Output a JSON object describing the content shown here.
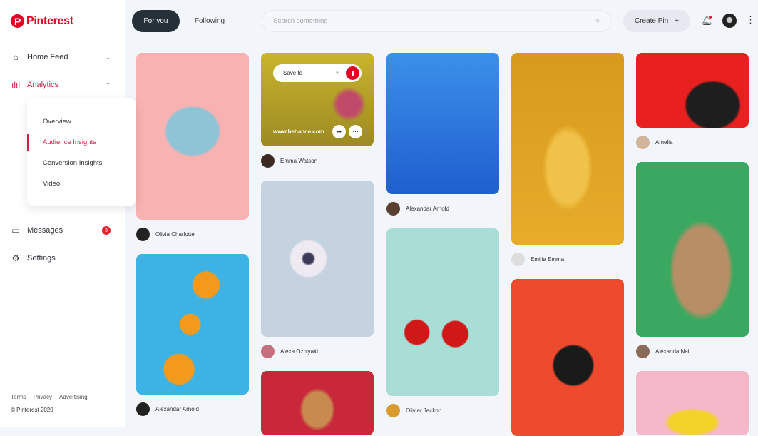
{
  "brand": {
    "name": "Pinterest",
    "mark": "P"
  },
  "sidebar": {
    "items": [
      {
        "label": "Home Feed"
      },
      {
        "label": "Analytics"
      },
      {
        "label": "Messages",
        "badge": "3"
      },
      {
        "label": "Settings"
      }
    ],
    "submenu": [
      "Overview",
      "Audience Insights",
      "Conversion Insights",
      "Video"
    ],
    "footer": [
      "Terms",
      "Privacy",
      "Advertising"
    ],
    "copyright": "© Pinterest 2020"
  },
  "header": {
    "tabs": [
      "For you",
      "Following"
    ],
    "search_placeholder": "Search something",
    "create_label": "Create Pin"
  },
  "overlay": {
    "save_to": "Save to",
    "site": "www.behance.com"
  },
  "authors": [
    "Olivia Charlotte",
    "Alexandar Arnold",
    "Emma Watson",
    "Alexa Ozniyaki",
    "Alexandar Arnold",
    "Oliviar Jeckob",
    "Emilia Emma",
    "Amelia",
    "Alexanda Nail"
  ],
  "colors": {
    "accent": "#e60023",
    "active": "#d31d45"
  }
}
